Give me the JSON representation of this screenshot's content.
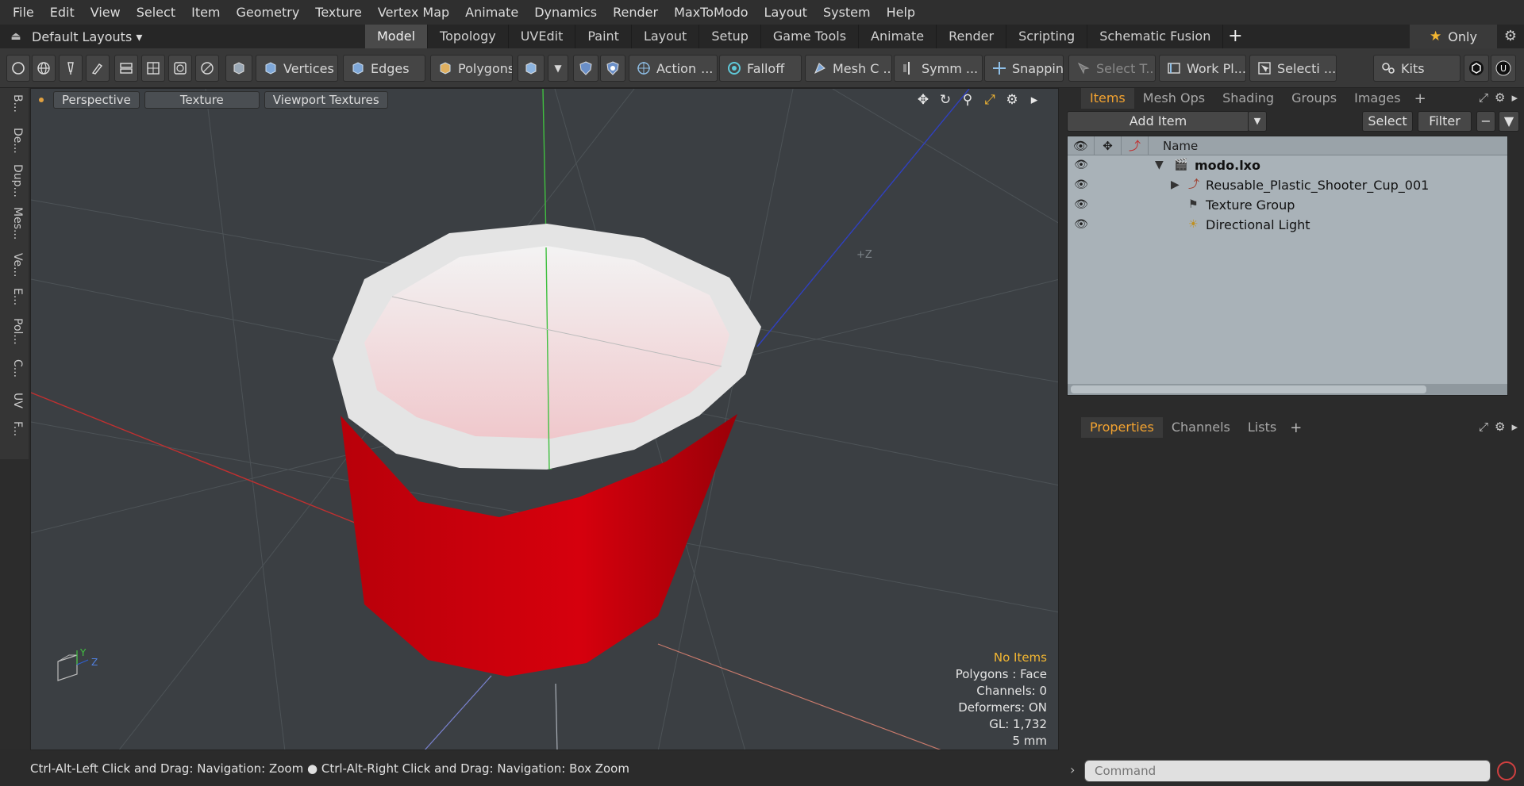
{
  "menu": [
    "File",
    "Edit",
    "View",
    "Select",
    "Item",
    "Geometry",
    "Texture",
    "Vertex Map",
    "Animate",
    "Dynamics",
    "Render",
    "MaxToModo",
    "Layout",
    "System",
    "Help"
  ],
  "layouts_label": "Default Layouts ▾",
  "layout_tabs": [
    {
      "label": "Model",
      "active": true
    },
    {
      "label": "Topology",
      "active": false
    },
    {
      "label": "UVEdit",
      "active": false
    },
    {
      "label": "Paint",
      "active": false
    },
    {
      "label": "Layout",
      "active": false
    },
    {
      "label": "Setup",
      "active": false
    },
    {
      "label": "Game Tools",
      "active": false
    },
    {
      "label": "Animate",
      "active": false
    },
    {
      "label": "Render",
      "active": false
    },
    {
      "label": "Scripting",
      "active": false
    },
    {
      "label": "Schematic Fusion",
      "active": false
    }
  ],
  "only_label": "Only",
  "toolbar": {
    "vertices": "Vertices",
    "edges": "Edges",
    "polygons": "Polygons",
    "action": "Action",
    "action_more": "...",
    "falloff": "Falloff",
    "mesh": "Mesh C ...",
    "symm": "Symm ...",
    "snapping": "Snapping",
    "select_t": "Select T...",
    "work_pl": "Work Pl...",
    "selecti": "Selecti ...",
    "kits": "Kits"
  },
  "left_tabs": [
    "B...",
    "De...",
    "Dup...",
    "Mes...",
    "Ve...",
    "E...",
    "Pol...",
    "C...",
    "UV",
    "F..."
  ],
  "viewport": {
    "view_mode": "Perspective",
    "shading": "Texture",
    "textures": "Viewport Textures",
    "axis_label": "+Z",
    "gizmo_y": "Y",
    "gizmo_z": "Z",
    "info": [
      "No Items",
      "Polygons : Face",
      "Channels: 0",
      "Deformers: ON",
      "GL: 1,732",
      "5 mm"
    ]
  },
  "status": {
    "left": "Ctrl-Alt-Left Click and Drag: Navigation: Zoom",
    "right": "Ctrl-Alt-Right Click and Drag: Navigation: Box Zoom"
  },
  "items_panel": {
    "tabs": [
      {
        "label": "Items",
        "active": true
      },
      {
        "label": "Mesh Ops",
        "active": false
      },
      {
        "label": "Shading",
        "active": false
      },
      {
        "label": "Groups",
        "active": false
      },
      {
        "label": "Images",
        "active": false
      }
    ],
    "add_item": "Add Item",
    "select": "Select",
    "filter": "Filter",
    "name_header": "Name",
    "rows": [
      {
        "label": "modo.lxo"
      },
      {
        "label": "Reusable_Plastic_Shooter_Cup_001"
      },
      {
        "label": "Texture Group"
      },
      {
        "label": "Directional Light"
      }
    ]
  },
  "props_panel": {
    "tabs": [
      {
        "label": "Properties",
        "active": true
      },
      {
        "label": "Channels",
        "active": false
      },
      {
        "label": "Lists",
        "active": false
      }
    ]
  },
  "command_placeholder": "Command",
  "colors": {
    "accent": "#f2a230",
    "cup_red": "#a80008",
    "x_axis": "#c03030",
    "y_axis": "#40c040",
    "z_axis": "#3040c0"
  }
}
